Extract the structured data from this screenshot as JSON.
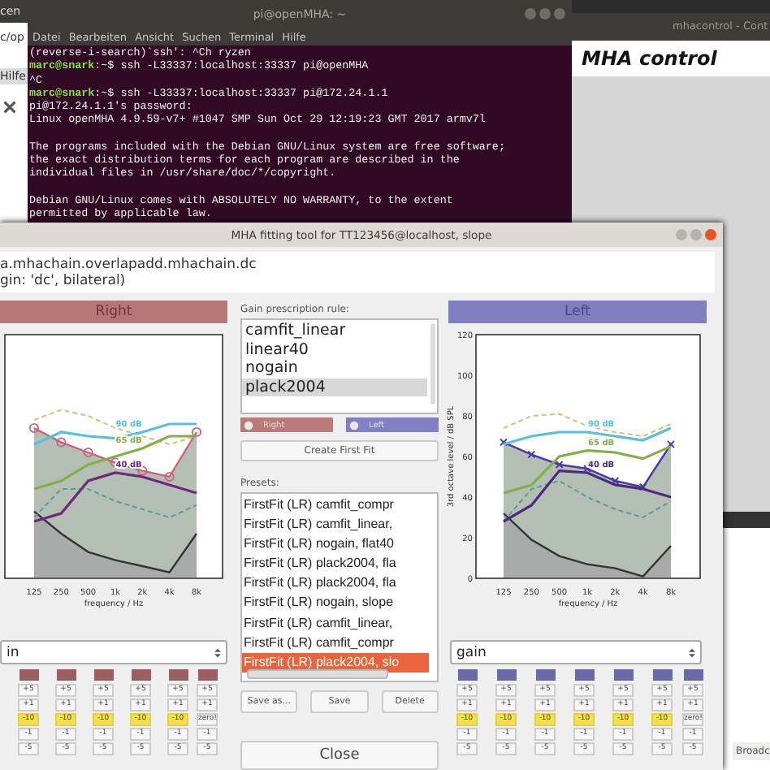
{
  "side_window": {
    "title": "cen",
    "path": "c/op",
    "menu": "Hilfe"
  },
  "terminal": {
    "title": "pi@openMHA: ~",
    "menu": [
      "Datei",
      "Bearbeiten",
      "Ansicht",
      "Suchen",
      "Terminal",
      "Hilfe"
    ],
    "blocks": [
      [
        {
          "text": "(reverse-i-search)`ssh': ^Ch ryzen"
        },
        {
          "prompt": "marc@snark",
          "text": ":~$ ssh -L33337:localhost:33337 pi@openMHA"
        },
        {
          "text": "^C"
        },
        {
          "prompt": "marc@snark",
          "text": ":~$ ssh -L33337:localhost:33337 pi@172.24.1.1"
        },
        {
          "text": "pi@172.24.1.1's password:"
        },
        {
          "text": "Linux openMHA 4.9.59-v7+ #1047 SMP Sun Oct 29 12:19:23 GMT 2017 armv7l"
        }
      ],
      [
        {
          "text": "The programs included with the Debian GNU/Linux system are free software;"
        },
        {
          "text": "the exact distribution terms for each program are described in the"
        },
        {
          "text": "individual files in /usr/share/doc/*/copyright."
        }
      ],
      [
        {
          "text": "Debian GNU/Linux comes with ABSOLUTELY NO WARRANTY, to the extent"
        },
        {
          "text": "permitted by applicable law."
        }
      ]
    ]
  },
  "control_window": {
    "title": "mhacontrol - Cont",
    "heading": "MHA control"
  },
  "back_window": {
    "button": "Broadc"
  },
  "fitting": {
    "title": "MHA fitting tool for TT123456@localhost, slope",
    "info": [
      "a.mhachain.overlapadd.mhachain.dc",
      "gin: 'dc', bilateral)"
    ],
    "sides": [
      {
        "label": "Right",
        "chart_data": {
          "type": "line",
          "categories": [
            "125",
            "250",
            "500",
            "1k",
            "2k",
            "4k",
            "8k"
          ],
          "xlabel": "frequency / Hz",
          "ylim": [
            0,
            120
          ],
          "series": [
            {
              "color": "#d0607a",
              "marker": "circle",
              "values": [
                74,
                67,
                62,
                57,
                53,
                50,
                72
              ]
            },
            {
              "color": "#333333",
              "values": [
                33,
                22,
                13,
                9,
                6,
                3,
                22
              ]
            },
            {
              "color": "#d8bf72",
              "line_style": "dashed",
              "values": [
                78,
                83,
                80,
                74,
                70,
                66,
                70
              ]
            },
            {
              "color": "#5b9a9f",
              "line_style": "dashed",
              "values": [
                30,
                44,
                44,
                38,
                34,
                30,
                36
              ]
            },
            {
              "name": "90 dB",
              "color": "#55c0dd",
              "values": [
                66,
                72,
                70,
                69,
                72,
                76,
                76
              ]
            },
            {
              "name": "65 dB",
              "color": "#7fb04a",
              "values": [
                44,
                48,
                56,
                60,
                64,
                70,
                70
              ]
            },
            {
              "name": "40 dB",
              "color": "#6a2c7a",
              "values": [
                28,
                32,
                48,
                52,
                50,
                46,
                42
              ]
            }
          ]
        },
        "gain": {
          "value": "in",
          "columns": [
            {
              "kind": "band",
              "active": true,
              "buttons": [
                "+5",
                "+1",
                "-10",
                "-1",
                "-5"
              ]
            },
            {
              "kind": "band",
              "active": true,
              "buttons": [
                "+5",
                "+1",
                "-10",
                "-1",
                "-5"
              ]
            },
            {
              "kind": "band",
              "active": true,
              "buttons": [
                "+5",
                "+1",
                "-10",
                "-1",
                "-5"
              ]
            },
            {
              "kind": "band",
              "active": true,
              "buttons": [
                "+5",
                "+1",
                "-10",
                "-1",
                "-5"
              ]
            },
            {
              "kind": "band",
              "active": true,
              "buttons": [
                "+5",
                "+1",
                "-10",
                "-1",
                "-5"
              ]
            },
            {
              "kind": "all",
              "active": false,
              "buttons": [
                "+5",
                "+1",
                "zero!",
                "-1",
                "-5"
              ]
            }
          ]
        }
      },
      {
        "label": "Left",
        "chart_data": {
          "type": "line",
          "categories": [
            "125",
            "250",
            "500",
            "1k",
            "2k",
            "4k",
            "8k"
          ],
          "xlabel": "frequency / Hz",
          "ylabel": "3rd octave level / dB SPL",
          "ylim": [
            0,
            120
          ],
          "yticks": [
            0,
            20,
            40,
            60,
            80,
            100,
            120
          ],
          "series": [
            {
              "color": "#4b38a8",
              "marker": "x",
              "values": [
                67,
                61,
                56,
                54,
                48,
                45,
                66
              ]
            },
            {
              "color": "#333333",
              "values": [
                32,
                19,
                11,
                7,
                5,
                1,
                16
              ]
            },
            {
              "color": "#d8bf72",
              "line_style": "dashed",
              "values": [
                74,
                80,
                81,
                75,
                72,
                70,
                76
              ]
            },
            {
              "color": "#5b9a9f",
              "line_style": "dashed",
              "values": [
                28,
                44,
                48,
                40,
                34,
                30,
                38
              ]
            },
            {
              "name": "90 dB",
              "color": "#55c0dd",
              "values": [
                66,
                70,
                72,
                72,
                70,
                68,
                74
              ]
            },
            {
              "name": "65 dB",
              "color": "#7fb04a",
              "values": [
                42,
                46,
                60,
                63,
                62,
                59,
                65
              ]
            },
            {
              "name": "40 dB",
              "color": "#4a2c7a",
              "values": [
                28,
                36,
                53,
                52,
                46,
                44,
                40
              ]
            }
          ]
        },
        "gain": {
          "value": "gain",
          "columns": [
            {
              "kind": "band",
              "active": true,
              "buttons": [
                "+5",
                "+1",
                "-10",
                "-1",
                "-5"
              ]
            },
            {
              "kind": "band",
              "active": true,
              "buttons": [
                "+5",
                "+1",
                "-10",
                "-1",
                "-5"
              ]
            },
            {
              "kind": "band",
              "active": true,
              "buttons": [
                "+5",
                "+1",
                "-10",
                "-1",
                "-5"
              ]
            },
            {
              "kind": "band",
              "active": true,
              "buttons": [
                "+5",
                "+1",
                "-10",
                "-1",
                "-5"
              ]
            },
            {
              "kind": "band",
              "active": true,
              "buttons": [
                "+5",
                "+1",
                "-10",
                "-1",
                "-5"
              ]
            },
            {
              "kind": "band",
              "active": true,
              "buttons": [
                "+5",
                "+1",
                "-10",
                "-1",
                "-5"
              ]
            },
            {
              "kind": "all",
              "active": false,
              "buttons": [
                "+5",
                "+1",
                "zero!",
                "-1",
                "-5"
              ]
            }
          ]
        }
      }
    ],
    "rule": {
      "label": "Gain prescription rule:",
      "items": [
        {
          "label": "camfit_linear",
          "selected": false
        },
        {
          "label": "linear40",
          "selected": false
        },
        {
          "label": "nogain",
          "selected": false
        },
        {
          "label": "plack2004",
          "selected": true
        }
      ]
    },
    "ear_toggles": [
      "Right",
      "Left"
    ],
    "create_button": "Create First Fit",
    "presets": {
      "label": "Presets:",
      "items": [
        {
          "label": "FirstFit (LR) camfit_compr",
          "selected": false
        },
        {
          "label": "FirstFit (LR) camfit_linear,",
          "selected": false
        },
        {
          "label": "FirstFit (LR) nogain, flat40",
          "selected": false
        },
        {
          "label": "FirstFit (LR) plack2004, fla",
          "selected": false
        },
        {
          "label": "FirstFit (LR) plack2004, fla",
          "selected": false
        },
        {
          "label": "FirstFit (LR) nogain, slope",
          "selected": false
        },
        {
          "label": "FirstFit (LR) camfit_linear,",
          "selected": false
        },
        {
          "label": "FirstFit (LR) camfit_compr",
          "selected": false
        },
        {
          "label": "FirstFit (LR) plack2004, slo",
          "selected": true
        }
      ]
    },
    "preset_buttons": [
      "Save as...",
      "Save",
      "Delete"
    ],
    "close": "Close"
  }
}
